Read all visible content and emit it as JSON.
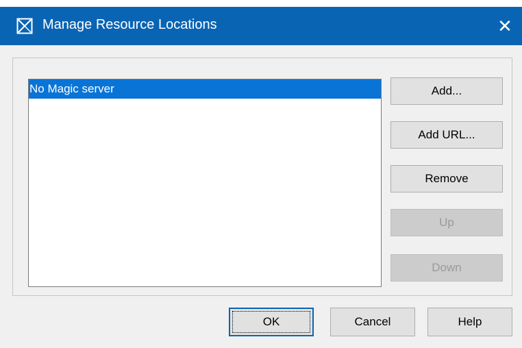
{
  "window": {
    "title": "Manage Resource Locations",
    "close_glyph": "✕",
    "icon": "magicdraw-app-icon"
  },
  "locations": {
    "items": [
      {
        "label": "No Magic server",
        "selected": true
      }
    ]
  },
  "side_buttons": {
    "add": "Add...",
    "add_url": "Add URL...",
    "remove": "Remove",
    "up": "Up",
    "down": "Down"
  },
  "footer_buttons": {
    "ok": "OK",
    "cancel": "Cancel",
    "help": "Help"
  },
  "colors": {
    "titlebar": "#0a64b4",
    "selection": "#0a74d6",
    "dialog_bg": "#f0f0f0"
  }
}
